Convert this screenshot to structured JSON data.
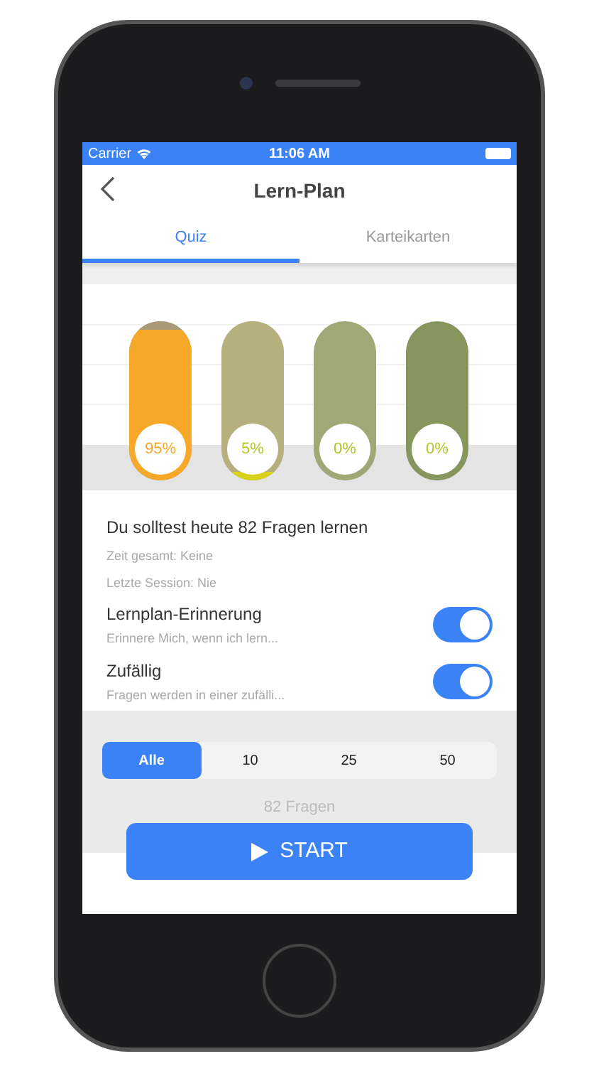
{
  "status_bar": {
    "carrier": "Carrier",
    "time": "11:06 AM"
  },
  "nav": {
    "title": "Lern-Plan"
  },
  "tabs": [
    {
      "label": "Quiz",
      "selected": true
    },
    {
      "label": "Karteikarten",
      "selected": false
    }
  ],
  "bars": [
    {
      "label": "95%",
      "level": 0.95,
      "color": "#a89a78"
    },
    {
      "label": "5%",
      "level": 0.05,
      "color": "#b5b07e"
    },
    {
      "label": "0%",
      "level": 0,
      "color": "#a0a878"
    },
    {
      "label": "0%",
      "level": 0,
      "color": "#87955f"
    }
  ],
  "summary": {
    "title": "Du solltest heute 82 Fragen lernen",
    "lines": [
      "Zeit gesamt: Keine",
      "Letzte Session: Nie"
    ]
  },
  "settings": [
    {
      "title": "Lernplan-Erinnerung",
      "subtitle": "Erinnere Mich, wenn ich lern...",
      "on": true
    },
    {
      "title": "Zufällig",
      "subtitle": "Fragen werden in einer zufälli...",
      "on": true
    }
  ],
  "segments": [
    {
      "label": "Alle",
      "selected": true
    },
    {
      "label": "10",
      "selected": false
    },
    {
      "label": "25",
      "selected": false
    },
    {
      "label": "50",
      "selected": false
    }
  ],
  "count": "82 Fragen",
  "start_button": "START"
}
